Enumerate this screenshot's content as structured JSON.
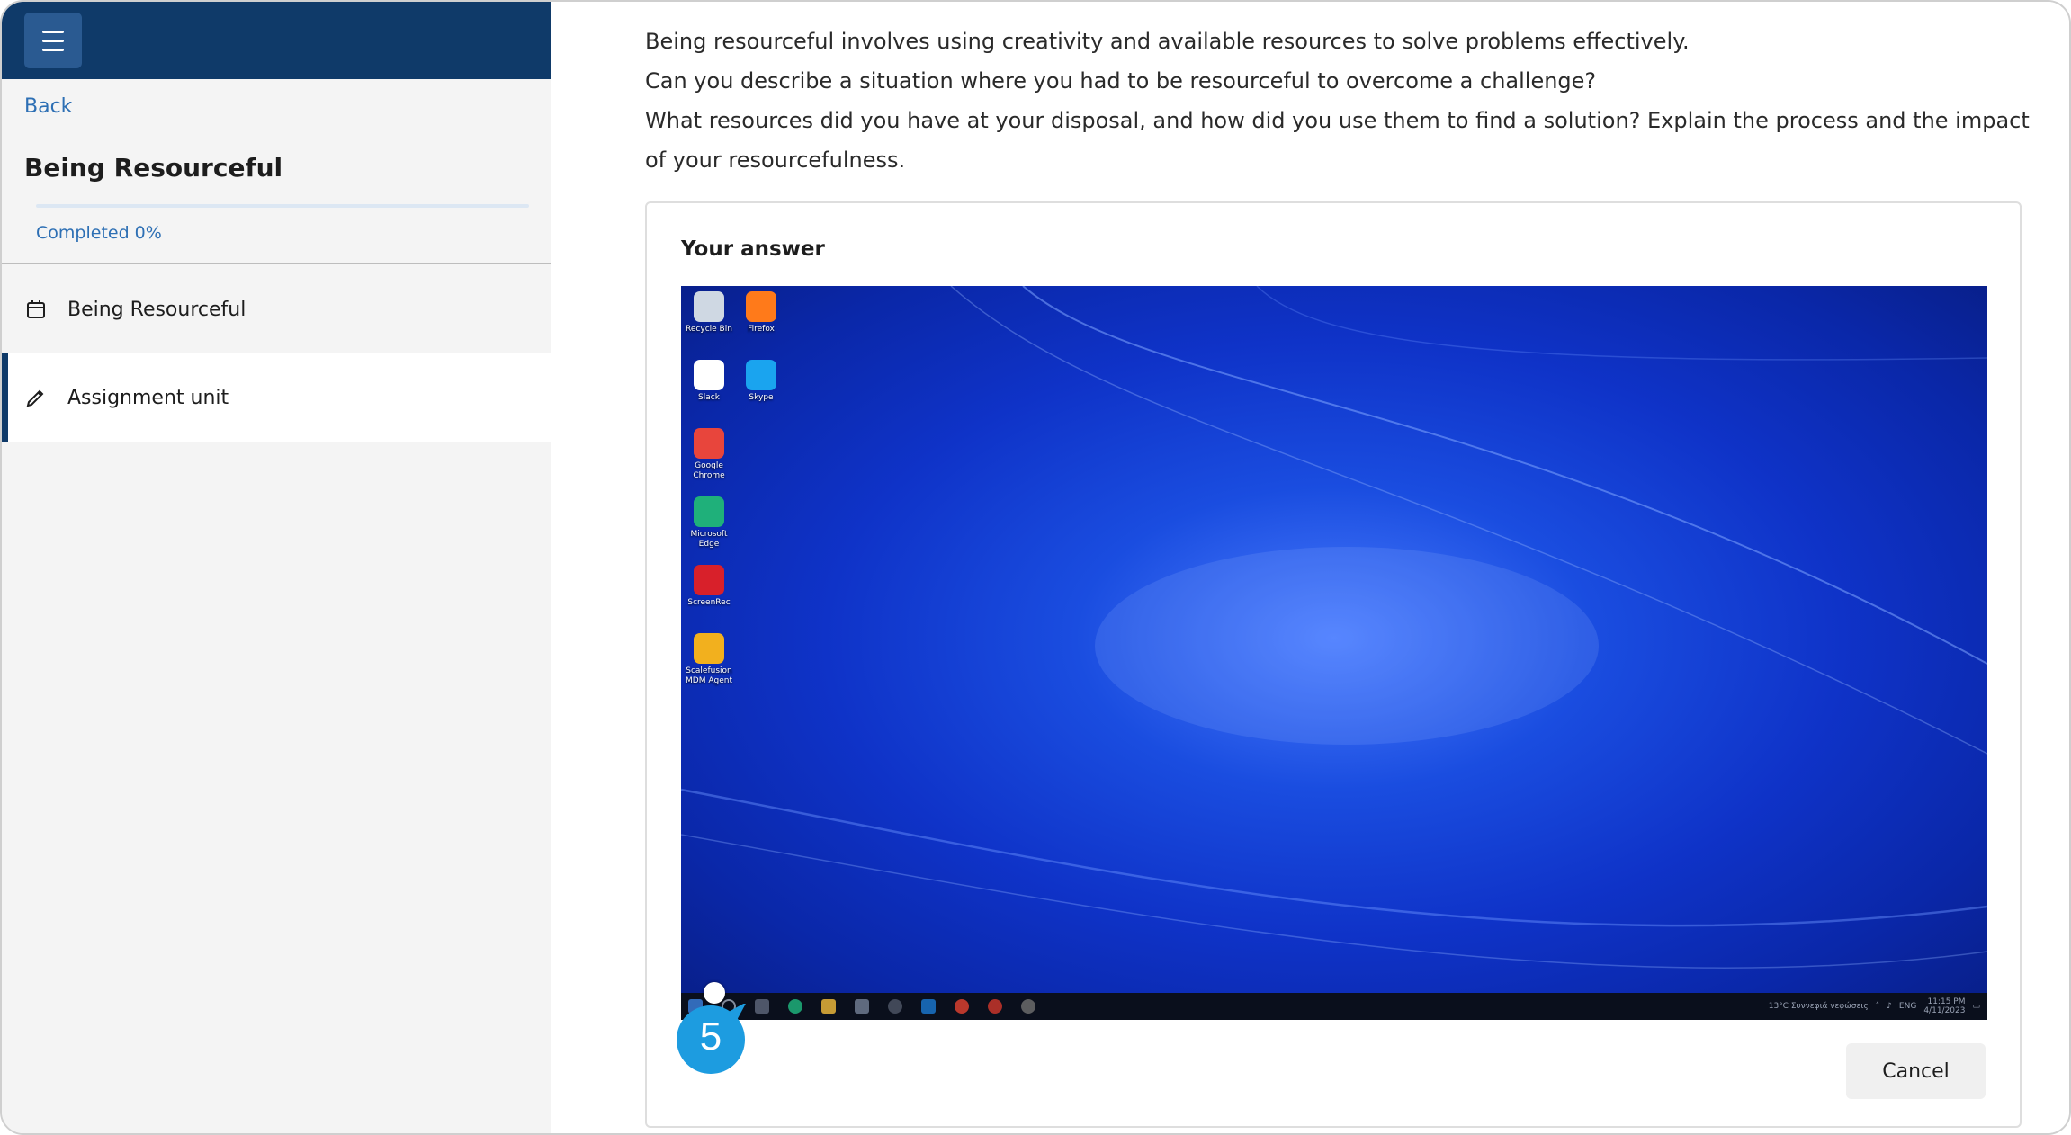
{
  "sidebar": {
    "menu_icon": "hamburger-menu-icon",
    "back_label": "Back",
    "course_title": "Being Resourceful",
    "progress": {
      "label": "Completed 0%",
      "percent": 0
    },
    "items": [
      {
        "label": "Being Resourceful",
        "icon": "calendar-icon",
        "active": false
      },
      {
        "label": "Assignment unit",
        "icon": "pencil-icon",
        "active": true
      }
    ]
  },
  "main": {
    "prompt_lines": [
      "Being resourceful involves using creativity and available resources to solve problems effectively.",
      "Can you describe a situation where you had to be resourceful to overcome a challenge?",
      "What resources did you have at your disposal, and how did you use them to find a solution? Explain the process and the impact of your resourcefulness."
    ],
    "answer_label": "Your answer",
    "cancel_label": "Cancel",
    "step_number": "5"
  },
  "desktop": {
    "icons": [
      {
        "label": "Recycle Bin",
        "color": "#cfd8e3"
      },
      {
        "label": "Firefox",
        "color": "#ff7a1a"
      },
      {
        "label": "Slack",
        "color": "#ffffff"
      },
      {
        "label": "Skype",
        "color": "#1aa4ef"
      },
      {
        "label": "Google Chrome",
        "color": "#e8453c"
      },
      {
        "label": "Microsoft Edge",
        "color": "#1fb07a"
      },
      {
        "label": "ScreenRec",
        "color": "#d8202a"
      },
      {
        "label": "Scalefusion MDM Agent",
        "color": "#f2b01e"
      }
    ],
    "taskbar_icons": [
      "windows-start-icon",
      "search-icon",
      "task-view-icon",
      "edge-icon",
      "file-explorer-icon",
      "store-icon",
      "media-icon",
      "outlook-icon",
      "chrome-icon",
      "chrome-alt-icon",
      "app-icon"
    ],
    "tray": {
      "weather": "13°C  Συννεφιά νεφώσεις",
      "language": "ENG",
      "time": "11:15 PM",
      "date": "4/11/2023"
    }
  }
}
